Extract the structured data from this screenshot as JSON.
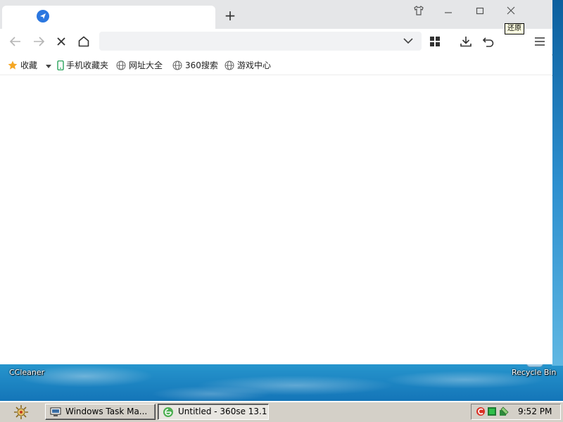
{
  "desktop": {
    "icons": [
      {
        "label": "CCleaner"
      },
      {
        "label": "Recycle Bin"
      }
    ]
  },
  "browser": {
    "tab": {
      "title": ""
    },
    "new_tab_label": "+",
    "tooltip": "还原",
    "address": {
      "value": "",
      "placeholder": ""
    },
    "bookmarks": [
      {
        "label": "收藏",
        "icon": "star-icon"
      },
      {
        "label": "手机收藏夹",
        "icon": "mobile-icon"
      },
      {
        "label": "网址大全",
        "icon": "globe-icon"
      },
      {
        "label": "360搜索",
        "icon": "globe-icon"
      },
      {
        "label": "游戏中心",
        "icon": "globe-icon"
      }
    ],
    "colors": {
      "accent": "#2b77e0",
      "star": "#f5a623",
      "mobile": "#29a35a"
    }
  },
  "taskbar": {
    "tasks": [
      {
        "label": "Windows Task Ma...",
        "icon": "computer-icon",
        "active": false
      },
      {
        "label": "Untitled - 360se 13.1",
        "icon": "browser-icon",
        "active": true
      }
    ],
    "clock": "9:52 PM"
  }
}
